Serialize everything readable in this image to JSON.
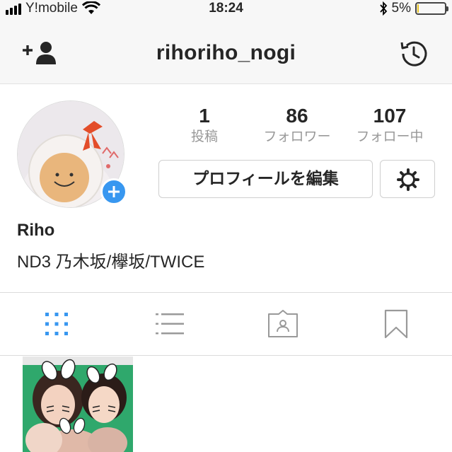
{
  "status_bar": {
    "carrier": "Y!mobile",
    "time": "18:24",
    "battery_percent": "5%",
    "battery_level": 0.05,
    "icons": [
      "signal-icon",
      "wifi-icon",
      "bluetooth-icon",
      "battery-icon"
    ]
  },
  "nav": {
    "username": "rihoriho_nogi",
    "left_icon": "add-user-icon",
    "right_icon": "archive-history-icon"
  },
  "profile": {
    "stats": [
      {
        "value": "1",
        "label": "投稿"
      },
      {
        "value": "86",
        "label": "フォロワー"
      },
      {
        "value": "107",
        "label": "フォロー中"
      }
    ],
    "edit_button_label": "プロフィールを編集",
    "settings_icon": "gear-icon",
    "add_story_icon": "plus-icon",
    "display_name": "Riho",
    "bio": "ND3 乃木坂/欅坂/TWICE"
  },
  "tabs": [
    {
      "icon": "grid-icon",
      "active": true
    },
    {
      "icon": "list-icon",
      "active": false
    },
    {
      "icon": "tagged-icon",
      "active": false
    },
    {
      "icon": "bookmark-icon",
      "active": false
    }
  ],
  "colors": {
    "accent_blue": "#3897f0",
    "active_tab": "#3897f0",
    "inactive_tab": "#999999",
    "muted_text": "#999999",
    "battery_low": "#e8c420"
  }
}
